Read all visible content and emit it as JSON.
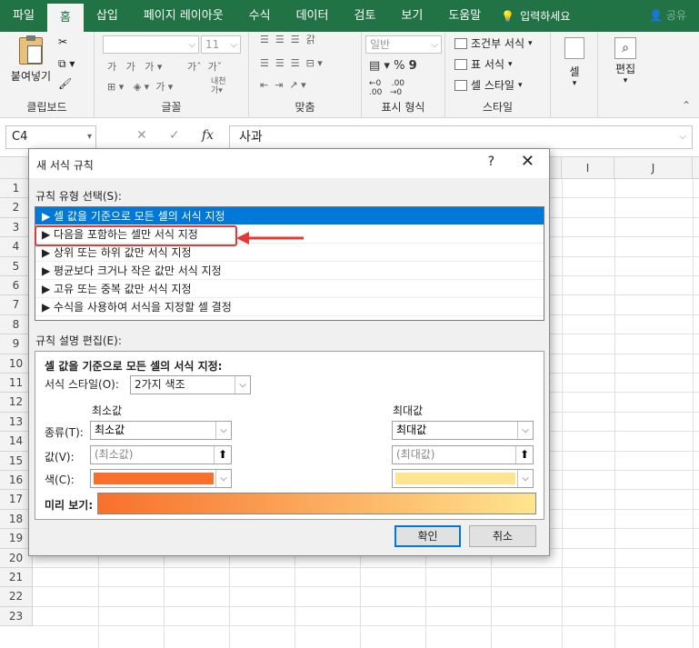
{
  "tabs": [
    "파일",
    "홈",
    "삽입",
    "페이지 레이아웃",
    "수식",
    "데이터",
    "검토",
    "보기",
    "도움말"
  ],
  "tell_me": "입력하세요",
  "share": "공유",
  "ribbon": {
    "clipboard": {
      "paste_label": "붙여넣기",
      "group": "클립보드"
    },
    "font": {
      "size": "11",
      "group": "글꼴"
    },
    "alignment": {
      "group": "맞춤"
    },
    "number": {
      "format": "일반",
      "group": "표시 형식"
    },
    "styles": {
      "conditional": "조건부 서식",
      "table": "표 서식",
      "cell_style": "셀 스타일",
      "group": "스타일"
    },
    "cells": {
      "label": "셀"
    },
    "editing": {
      "label": "편집"
    }
  },
  "formula_bar": {
    "name_box": "C4",
    "fx": "fx",
    "value": "사과"
  },
  "grid": {
    "columns": [
      "I",
      "J"
    ],
    "rows": [
      "1",
      "2",
      "3",
      "4",
      "5",
      "6",
      "7",
      "8",
      "9",
      "10",
      "11",
      "12",
      "13",
      "14",
      "15",
      "16",
      "17",
      "18",
      "19",
      "20",
      "21",
      "22",
      "23"
    ]
  },
  "dialog": {
    "title": "새 서식 규칙",
    "help": "?",
    "close": "✕",
    "rule_type_label": "규칙 유형 선택(S):",
    "rule_types": [
      "▶ 셀 값을 기준으로 모든 셀의 서식 지정",
      "▶ 다음을 포함하는 셀만 서식 지정",
      "▶ 상위 또는 하위 값만 서식 지정",
      "▶ 평균보다 크거나 작은 값만 서식 지정",
      "▶ 고유 또는 중복 값만 서식 지정",
      "▶ 수식을 사용하여 서식을 지정할 셀 결정"
    ],
    "edit_label": "규칙 설명 편집(E):",
    "edit_title": "셀 값을 기준으로 모든 셀의 서식 지정:",
    "format_style_label": "서식 스타일(O):",
    "format_style_value": "2가지 색조",
    "min_header": "최소값",
    "max_header": "최대값",
    "type_label": "종류(T):",
    "min_type": "최소값",
    "max_type": "최대값",
    "value_label": "값(V):",
    "min_value_placeholder": "(최소값)",
    "max_value_placeholder": "(최대값)",
    "color_label": "색(C):",
    "min_color": "#f8702b",
    "max_color": "#ffe58f",
    "preview_label": "미리 보기:",
    "ok": "확인",
    "cancel": "취소"
  },
  "colors": {
    "accent": "#217346",
    "selection": "#0078d7",
    "highlight": "#e53935"
  }
}
